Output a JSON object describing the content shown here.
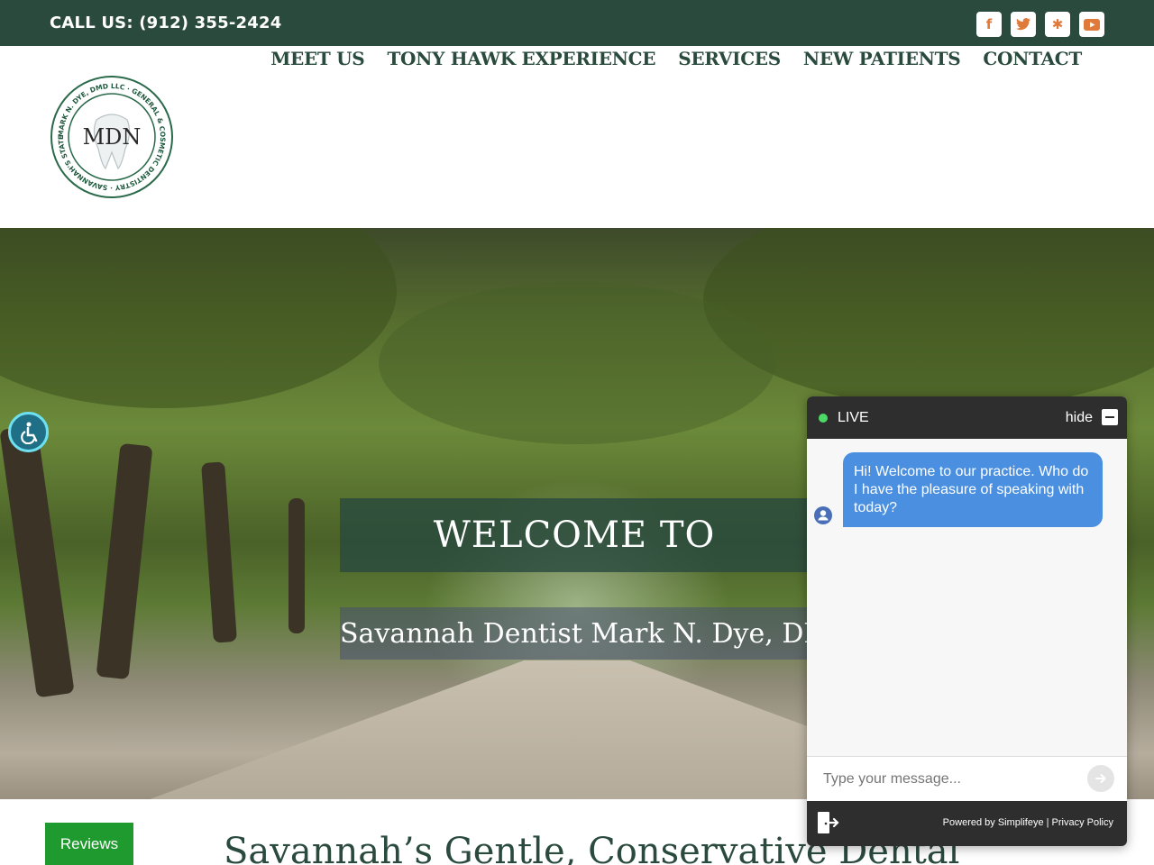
{
  "topbar": {
    "phone": "CALL US: (912) 355-2424",
    "socials": [
      {
        "icon": "facebook-icon",
        "glyph": "f"
      },
      {
        "icon": "twitter-icon",
        "glyph": "t"
      },
      {
        "icon": "yelp-icon",
        "glyph": "✱"
      },
      {
        "icon": "youtube-icon",
        "glyph": "▶"
      }
    ]
  },
  "nav": {
    "items": [
      "MEET US",
      "TONY HAWK EXPERIENCE",
      "SERVICES",
      "NEW PATIENTS",
      "CONTACT"
    ]
  },
  "logo": {
    "ring_text": "MARK N. DYE, DMD LLC · GENERAL & COSMETIC DENTISTRY · SAVANNAH'S STATE-OF-THE-ART DENTAL CENTER",
    "monogram": "MDN"
  },
  "hero": {
    "welcome": "WELCOME TO",
    "subtitle": "Savannah Dentist Mark N. Dye, DMD"
  },
  "reviews_label": "Reviews",
  "section_title": "Savannah’s Gentle, Conservative Dental",
  "chat": {
    "status": "LIVE",
    "hide_label": "hide",
    "message": "Hi! Welcome to our practice.  Who do I have the pleasure of speaking with today?",
    "input_placeholder": "Type your message...",
    "footer": "Powered by Simplifeye | Privacy Policy"
  },
  "colors": {
    "brand_green": "#2a4a3e",
    "social_orange": "#e07a3a",
    "chat_blue": "#4a8fe0",
    "reviews_green": "#1f9a2e"
  }
}
